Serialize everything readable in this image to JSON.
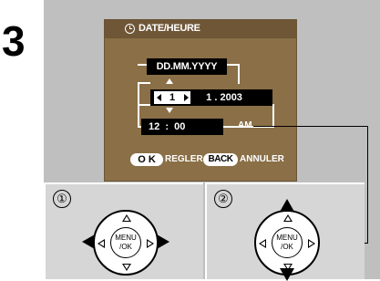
{
  "step": {
    "number": "3"
  },
  "screen": {
    "title": "DATE/HEURE",
    "format": "DD.MM.YYYY",
    "date": {
      "selected": "1",
      "rest": "   1 . 2003"
    },
    "time": "12  :  00",
    "ampm": "AM",
    "softkeys": {
      "ok_key": "O K",
      "ok_label": "REGLER",
      "back_key": "BACK",
      "back_label": "ANNULER"
    }
  },
  "panels": [
    {
      "number": "①",
      "dial_label": "MENU\n/OK"
    },
    {
      "number": "②",
      "dial_label": "MENU\n/OK"
    }
  ],
  "colors": {
    "lcd": "#8a6f47",
    "frame": "#bfbfbf",
    "panel": "#d6d6d6"
  }
}
